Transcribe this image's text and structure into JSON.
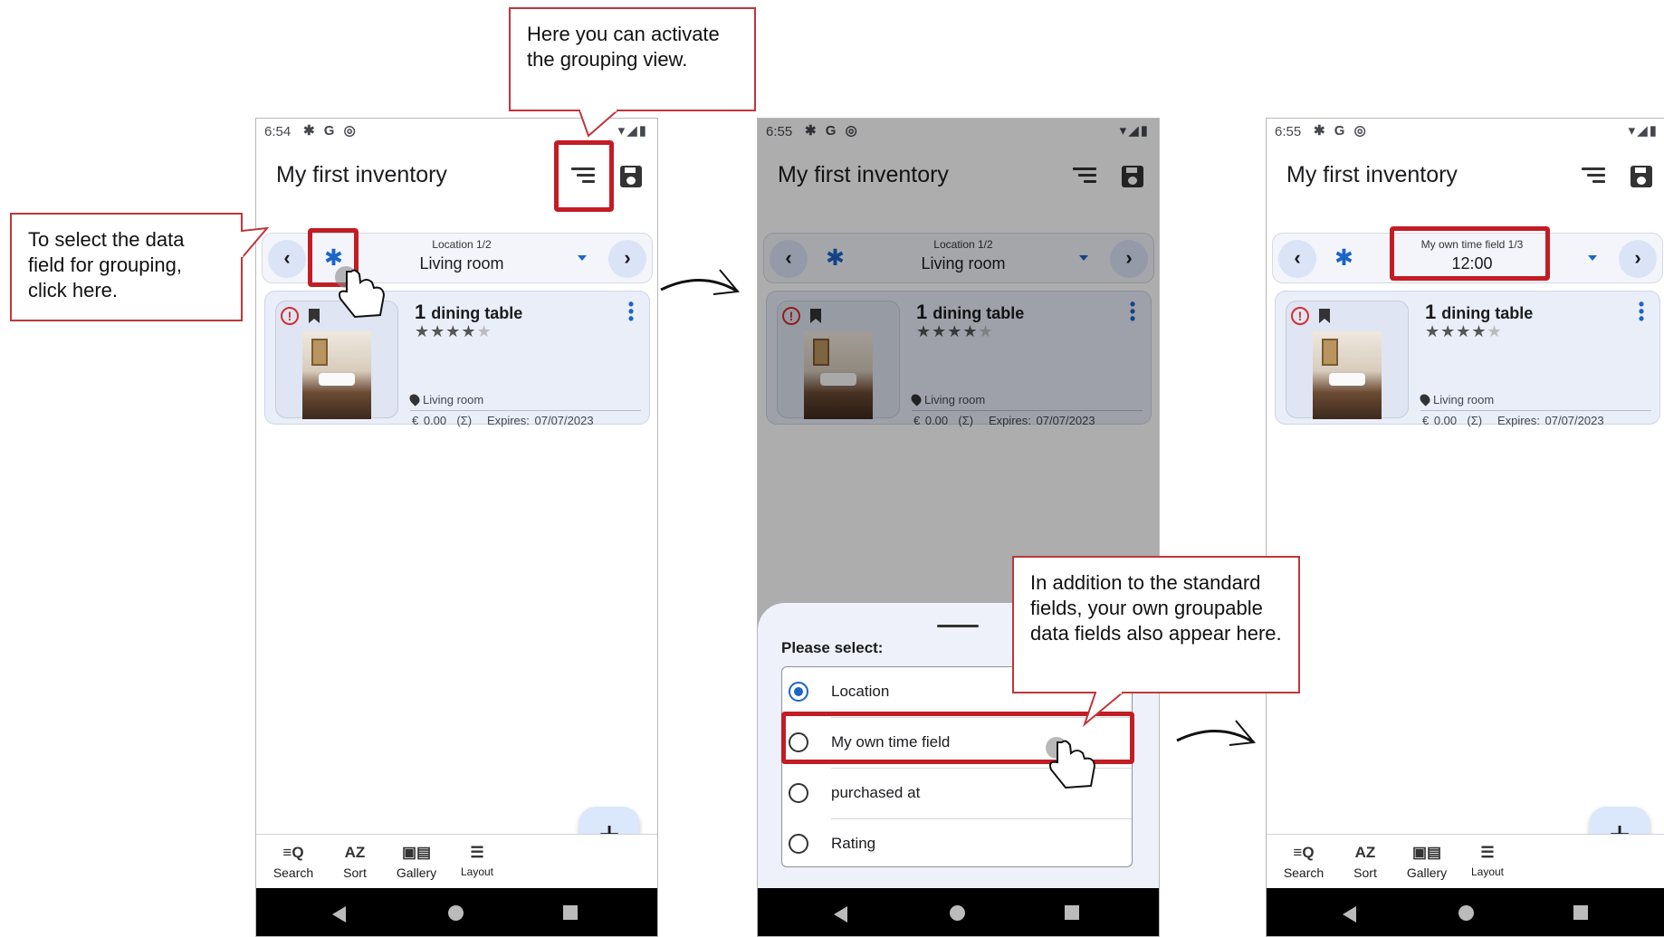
{
  "screens": [
    {
      "status": {
        "time": "6:54",
        "icons": "✱ G ◎",
        "right": "▾◢▮"
      },
      "title": "My first inventory",
      "group_caption": "Location 1/2",
      "group_value": "Living room",
      "item": {
        "qty": "1",
        "name": "dining table",
        "location": "Living room",
        "price": "€ 0.00",
        "sum": "(Σ)",
        "expires": "Expires: 07/07/2023",
        "rating": 4
      },
      "bottom": {
        "search": "Search",
        "sort": "Sort",
        "gallery": "Gallery",
        "layout": "Layout"
      }
    },
    {
      "status": {
        "time": "6:55",
        "icons": "✱ G ◎",
        "right": "▾◢▮"
      },
      "title": "My first inventory",
      "group_caption": "Location 1/2",
      "group_value": "Living room",
      "item": {
        "qty": "1",
        "name": "dining table",
        "location": "Living room",
        "price": "€ 0.00",
        "sum": "(Σ)",
        "expires": "Expires: 07/07/2023",
        "rating": 4
      },
      "sheet": {
        "prompt": "Please select:",
        "options": [
          "Location",
          "My own time field",
          "purchased at",
          "Rating"
        ],
        "selected": 0
      }
    },
    {
      "status": {
        "time": "6:55",
        "icons": "✱ G ◎",
        "right": "▾◢▮"
      },
      "title": "My first inventory",
      "group_caption": "My own time field 1/3",
      "group_value": "12:00",
      "item": {
        "qty": "1",
        "name": "dining table",
        "location": "Living room",
        "price": "€ 0.00",
        "sum": "(Σ)",
        "expires": "Expires: 07/07/2023",
        "rating": 4
      },
      "bottom": {
        "search": "Search",
        "sort": "Sort",
        "gallery": "Gallery",
        "layout": "Layout"
      }
    }
  ],
  "callouts": {
    "grouping_view": "Here you can activate the grouping view.",
    "data_field": "To select the data field for grouping, click here.",
    "own_fields": "In addition to the standard fields, your own groupable data fields also appear here."
  },
  "colors": {
    "accent": "#1c64c8",
    "highlight": "#c31c24",
    "card": "#e9eef9",
    "alert": "#d32f2f"
  }
}
